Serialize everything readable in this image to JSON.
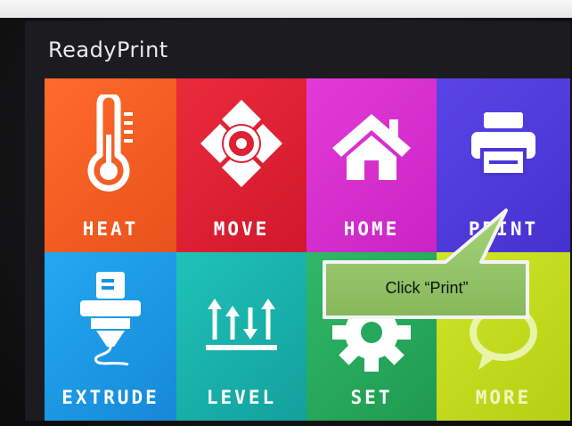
{
  "app": {
    "title": "ReadyPrint"
  },
  "tiles": [
    {
      "id": "heat",
      "label": "HEAT",
      "color": "#ff6a2c",
      "icon": "thermometer-icon"
    },
    {
      "id": "move",
      "label": "MOVE",
      "color": "#ec2a3c",
      "icon": "move-arrows-icon"
    },
    {
      "id": "home",
      "label": "HOME",
      "color": "#e23ad8",
      "icon": "house-icon"
    },
    {
      "id": "print",
      "label": "PRINT",
      "color": "#5a44e6",
      "icon": "printer-icon"
    },
    {
      "id": "extrude",
      "label": "EXTRUDE",
      "color": "#23a9f0",
      "icon": "extruder-nozzle-icon"
    },
    {
      "id": "level",
      "label": "LEVEL",
      "color": "#1fc2b8",
      "icon": "level-arrows-icon"
    },
    {
      "id": "set",
      "label": "SET",
      "color": "#2fb867",
      "icon": "gear-icon"
    },
    {
      "id": "more",
      "label": "MORE",
      "color": "#cfe52a",
      "icon": "chat-bubble-icon"
    }
  ],
  "annotation": {
    "text": "Click “Print”",
    "fill": "#8fbf63"
  }
}
